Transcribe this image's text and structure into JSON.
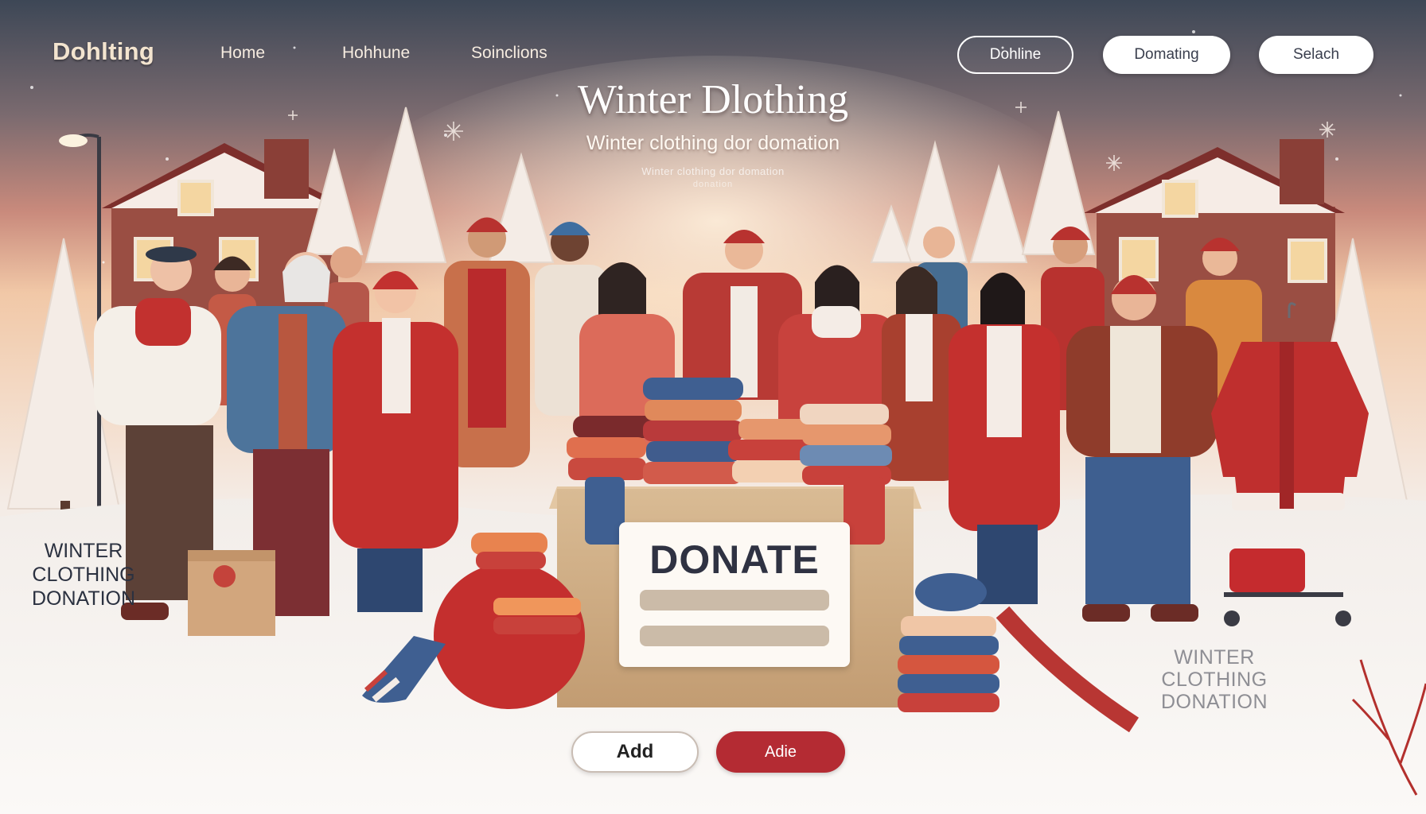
{
  "nav": {
    "brand": "Dohlting",
    "links": [
      "Home",
      "Hohhune",
      "Soinclions"
    ],
    "buttons": {
      "outline": "Dohline",
      "white": "Domating",
      "search": "Selach"
    }
  },
  "hero": {
    "title": "Winter Dlothing",
    "subtitle": "Winter clothing dor domation",
    "fine_line_1": "Winter clothing dor domation",
    "fine_line_2": "donation"
  },
  "donate_box": {
    "label": "DONATE"
  },
  "actions": {
    "add_label": "Add",
    "adie_label": "Adie"
  },
  "side_left": {
    "lines": [
      "WINTER",
      "CLOTHING",
      "DONATION"
    ]
  },
  "side_right": {
    "lines": [
      "WINTER",
      "CLOTHING",
      "DONATION"
    ]
  },
  "colors": {
    "accent_red": "#b42b33",
    "navy_sky": "#3d4756",
    "snow": "#f7f3f0",
    "wood": "#8c4a3c"
  }
}
